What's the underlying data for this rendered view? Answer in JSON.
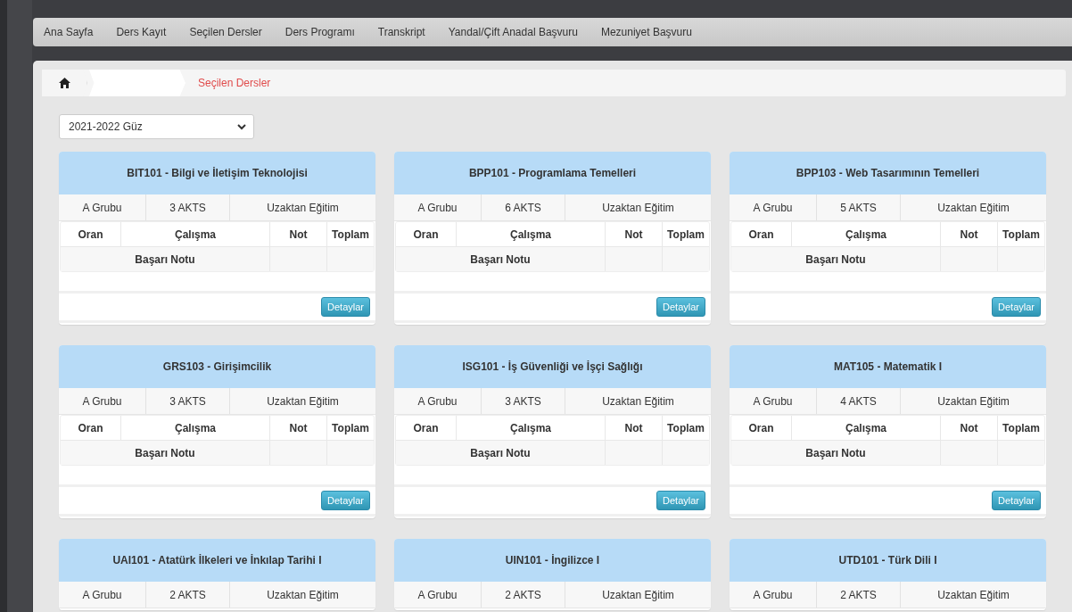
{
  "nav": [
    {
      "label": "Ana Sayfa"
    },
    {
      "label": "Ders Kayıt"
    },
    {
      "label": "Seçilen Dersler"
    },
    {
      "label": "Ders Programı"
    },
    {
      "label": "Transkript"
    },
    {
      "label": "Yandal/Çift Anadal Başvuru"
    },
    {
      "label": "Mezuniyet Başvuru"
    }
  ],
  "breadcrumb": {
    "current": "Seçilen Dersler"
  },
  "term_select": {
    "value": "2021-2022 Güz"
  },
  "cards": [
    {
      "title": "BIT101 - Bilgi ve İletişim Teknolojisi",
      "group": "A Grubu",
      "credits": "3 AKTS",
      "mode": "Uzaktan Eğitim",
      "columns": [
        "Oran",
        "Çalışma",
        "Not",
        "Toplam"
      ],
      "summary": "Başarı Notu",
      "button": "Detaylar"
    },
    {
      "title": "BPP101 - Programlama Temelleri",
      "group": "A Grubu",
      "credits": "6 AKTS",
      "mode": "Uzaktan Eğitim",
      "columns": [
        "Oran",
        "Çalışma",
        "Not",
        "Toplam"
      ],
      "summary": "Başarı Notu",
      "button": "Detaylar"
    },
    {
      "title": "BPP103 - Web Tasarımının Temelleri",
      "group": "A Grubu",
      "credits": "5 AKTS",
      "mode": "Uzaktan Eğitim",
      "columns": [
        "Oran",
        "Çalışma",
        "Not",
        "Toplam"
      ],
      "summary": "Başarı Notu",
      "button": "Detaylar"
    },
    {
      "title": "GRS103 - Girişimcilik",
      "group": "A Grubu",
      "credits": "3 AKTS",
      "mode": "Uzaktan Eğitim",
      "columns": [
        "Oran",
        "Çalışma",
        "Not",
        "Toplam"
      ],
      "summary": "Başarı Notu",
      "button": "Detaylar"
    },
    {
      "title": "ISG101 - İş Güvenliği ve İşçi Sağlığı",
      "group": "A Grubu",
      "credits": "3 AKTS",
      "mode": "Uzaktan Eğitim",
      "columns": [
        "Oran",
        "Çalışma",
        "Not",
        "Toplam"
      ],
      "summary": "Başarı Notu",
      "button": "Detaylar"
    },
    {
      "title": "MAT105 - Matematik I",
      "group": "A Grubu",
      "credits": "4 AKTS",
      "mode": "Uzaktan Eğitim",
      "columns": [
        "Oran",
        "Çalışma",
        "Not",
        "Toplam"
      ],
      "summary": "Başarı Notu",
      "button": "Detaylar"
    },
    {
      "title": "UAI101 - Atatürk İlkeleri ve İnkılap Tarihi I",
      "group": "A Grubu",
      "credits": "2 AKTS",
      "mode": "Uzaktan Eğitim"
    },
    {
      "title": "UIN101 - İngilizce I",
      "group": "A Grubu",
      "credits": "2 AKTS",
      "mode": "Uzaktan Eğitim"
    },
    {
      "title": "UTD101 - Türk Dili I",
      "group": "A Grubu",
      "credits": "2 AKTS",
      "mode": "Uzaktan Eğitim"
    }
  ]
}
